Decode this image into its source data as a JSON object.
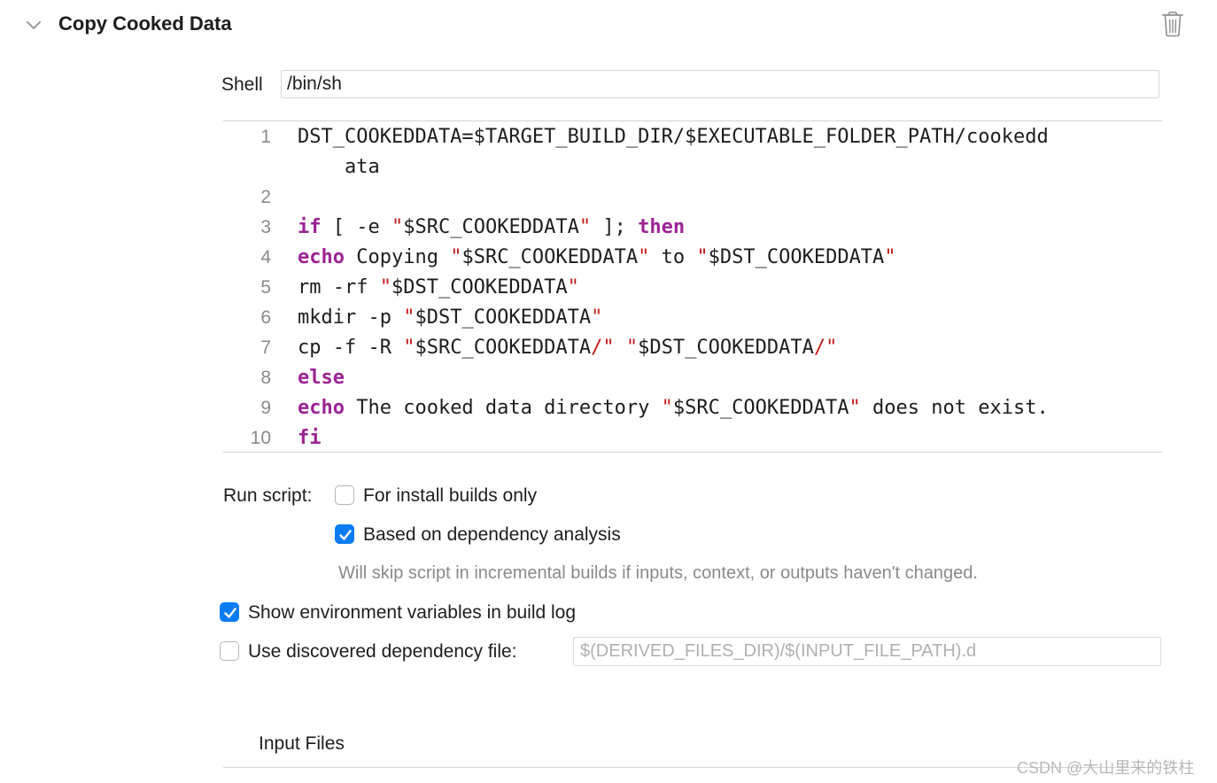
{
  "header": {
    "title": "Copy Cooked Data",
    "disclosure_icon": "chevron-down-icon",
    "delete_icon": "trash-icon"
  },
  "shell": {
    "label": "Shell",
    "value": "/bin/sh"
  },
  "script": {
    "lines": [
      {
        "num": "1",
        "tokens": [
          {
            "t": "DST_COOKEDDATA=$TARGET_BUILD_DIR/$EXECUTABLE_FOLDER_PATH/cookedd",
            "k": "plain"
          }
        ]
      },
      {
        "num": "",
        "tokens": [
          {
            "t": "    ata",
            "k": "plain"
          }
        ]
      },
      {
        "num": "2",
        "tokens": []
      },
      {
        "num": "3",
        "tokens": [
          {
            "t": "if",
            "k": "kw"
          },
          {
            "t": " [ -e ",
            "k": "plain"
          },
          {
            "t": "\"",
            "k": "str"
          },
          {
            "t": "$SRC_COOKEDDATA",
            "k": "plain"
          },
          {
            "t": "\"",
            "k": "str"
          },
          {
            "t": " ]; ",
            "k": "plain"
          },
          {
            "t": "then",
            "k": "kw"
          }
        ]
      },
      {
        "num": "4",
        "tokens": [
          {
            "t": "echo",
            "k": "kw"
          },
          {
            "t": " Copying ",
            "k": "plain"
          },
          {
            "t": "\"",
            "k": "str"
          },
          {
            "t": "$SRC_COOKEDDATA",
            "k": "plain"
          },
          {
            "t": "\"",
            "k": "str"
          },
          {
            "t": " to ",
            "k": "plain"
          },
          {
            "t": "\"",
            "k": "str"
          },
          {
            "t": "$DST_COOKEDDATA",
            "k": "plain"
          },
          {
            "t": "\"",
            "k": "str"
          }
        ]
      },
      {
        "num": "5",
        "tokens": [
          {
            "t": "rm -rf ",
            "k": "plain"
          },
          {
            "t": "\"",
            "k": "str"
          },
          {
            "t": "$DST_COOKEDDATA",
            "k": "plain"
          },
          {
            "t": "\"",
            "k": "str"
          }
        ]
      },
      {
        "num": "6",
        "tokens": [
          {
            "t": "mkdir -p ",
            "k": "plain"
          },
          {
            "t": "\"",
            "k": "str"
          },
          {
            "t": "$DST_COOKEDDATA",
            "k": "plain"
          },
          {
            "t": "\"",
            "k": "str"
          }
        ]
      },
      {
        "num": "7",
        "tokens": [
          {
            "t": "cp -f -R ",
            "k": "plain"
          },
          {
            "t": "\"",
            "k": "str"
          },
          {
            "t": "$SRC_COOKEDDATA",
            "k": "plain"
          },
          {
            "t": "/\"",
            "k": "str"
          },
          {
            "t": " ",
            "k": "plain"
          },
          {
            "t": "\"",
            "k": "str"
          },
          {
            "t": "$DST_COOKEDDATA",
            "k": "plain"
          },
          {
            "t": "/\"",
            "k": "str"
          }
        ]
      },
      {
        "num": "8",
        "tokens": [
          {
            "t": "else",
            "k": "kw"
          }
        ]
      },
      {
        "num": "9",
        "tokens": [
          {
            "t": "echo",
            "k": "kw"
          },
          {
            "t": " The cooked data directory ",
            "k": "plain"
          },
          {
            "t": "\"",
            "k": "str"
          },
          {
            "t": "$SRC_COOKEDDATA",
            "k": "plain"
          },
          {
            "t": "\"",
            "k": "str"
          },
          {
            "t": " does not exist.",
            "k": "plain"
          }
        ]
      },
      {
        "num": "10",
        "tokens": [
          {
            "t": "fi",
            "k": "kw"
          }
        ]
      }
    ]
  },
  "run_script": {
    "label": "Run script:",
    "install_builds_only": {
      "label": "For install builds only",
      "checked": false
    },
    "dependency_analysis": {
      "label": "Based on dependency analysis",
      "checked": true
    },
    "hint": "Will skip script in incremental builds if inputs, context, or outputs haven't changed."
  },
  "show_env_vars": {
    "label": "Show environment variables in build log",
    "checked": true
  },
  "discovered_dep_file": {
    "label": "Use discovered dependency file:",
    "checked": false,
    "placeholder": "$(DERIVED_FILES_DIR)/$(INPUT_FILE_PATH).d"
  },
  "input_files": {
    "label": "Input Files"
  },
  "watermark": "CSDN @大山里来的铁柱",
  "colors": {
    "keyword": "#9b2393",
    "string": "#c41a16",
    "checkbox_accent": "#0a7cf3"
  }
}
